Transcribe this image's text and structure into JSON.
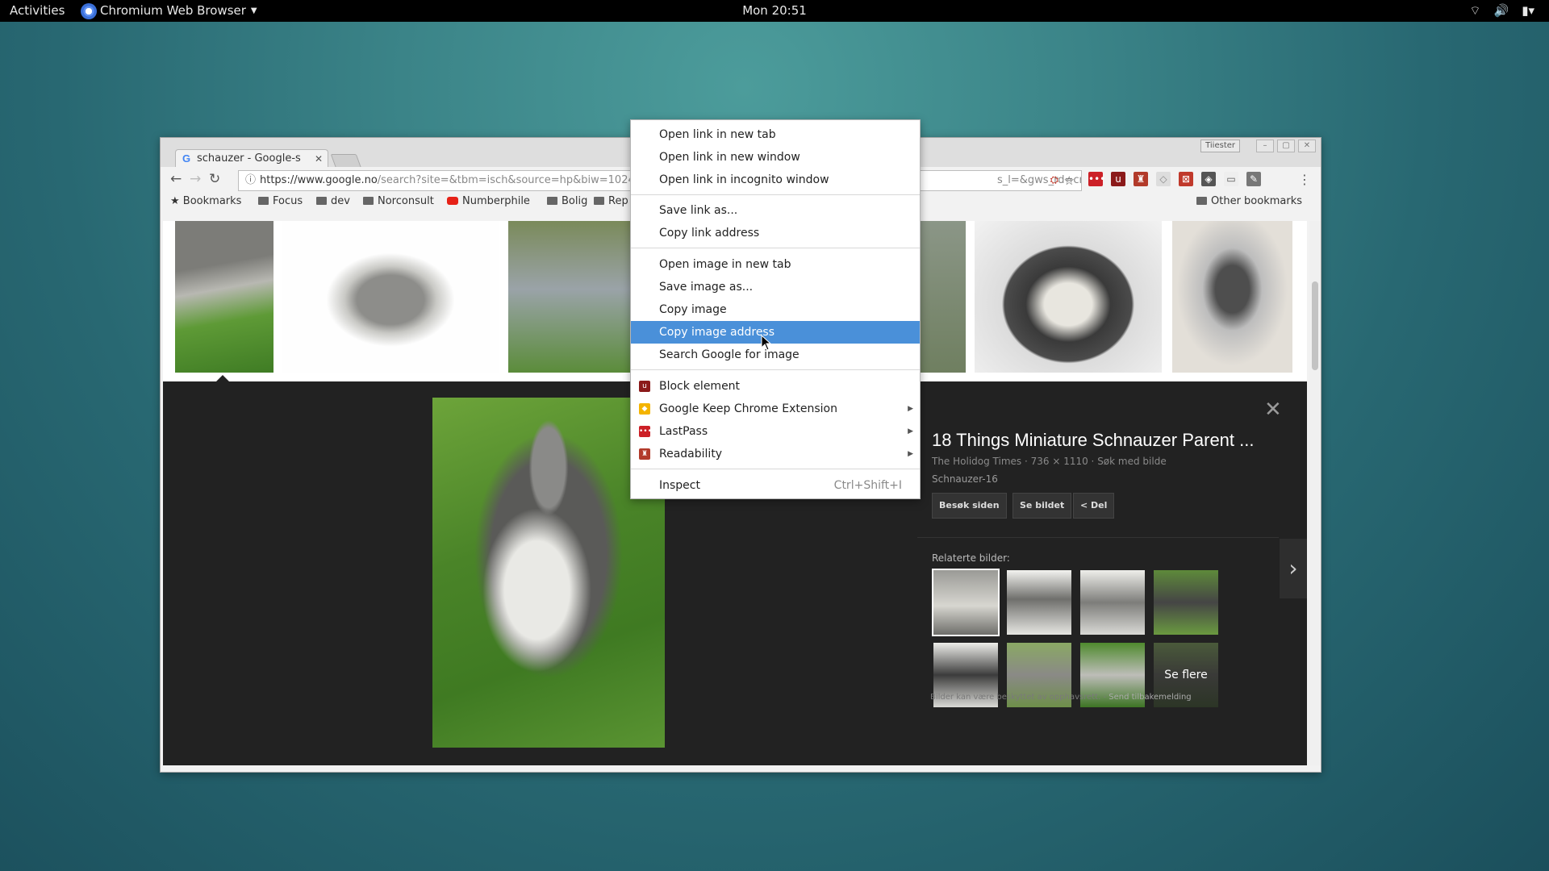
{
  "topbar": {
    "activities": "Activities",
    "app_name": "Chromium Web Browser",
    "clock": "Mon 20:51"
  },
  "browser": {
    "tab_title": "schauzer - Google-s",
    "profile_button": "Tiiester",
    "url_host": "https://www.google.no",
    "url_path": "/search?site=&tbm=isch&source=hp&biw=1024",
    "url_right": "s_l=&gws_rd=cr&ei=i5",
    "bookmarks": {
      "bookmarks": "Bookmarks",
      "focus": "Focus",
      "dev": "dev",
      "norconsult": "Norconsult",
      "numberphile": "Numberphile",
      "bolig": "Bolig",
      "rep": "Rep",
      "other": "Other bookmarks"
    }
  },
  "panel": {
    "title": "18 Things Miniature Schnauzer Parent ...",
    "meta": "The Holidog Times · 736 × 1110 · Søk med bilde",
    "subtitle": "Schnauzer-16",
    "visit_button": "Besøk siden",
    "view_button": "Se bildet",
    "share_button": "Del",
    "related_label": "Relaterte bilder:",
    "see_more": "Se flere",
    "copyright": "Bilder kan være beskyttet av opphavsrett. -",
    "feedback": "Send tilbakemelding"
  },
  "context_menu": {
    "open_new_tab": "Open link in new tab",
    "open_new_window": "Open link in new window",
    "open_incognito": "Open link in incognito window",
    "save_link": "Save link as...",
    "copy_link": "Copy link address",
    "open_image": "Open image in new tab",
    "save_image": "Save image as...",
    "copy_image": "Copy image",
    "copy_image_address": "Copy image address",
    "search_image": "Search Google for image",
    "block_element": "Block element",
    "keep_ext": "Google Keep Chrome Extension",
    "lastpass": "LastPass",
    "readability": "Readability",
    "inspect": "Inspect",
    "inspect_shortcut": "Ctrl+Shift+I"
  },
  "colors": {
    "menu_highlight": "#4a90d9",
    "panel_background": "#222222",
    "desktop_teal": "#3b8488"
  },
  "icons": [
    "chromium-icon",
    "wifi-icon",
    "volume-icon",
    "battery-icon",
    "star-icon",
    "folder-icon",
    "youtube-icon",
    "ublock-icon",
    "keep-icon",
    "lastpass-icon",
    "readability-icon",
    "close-icon",
    "chevron-right-icon",
    "share-icon"
  ]
}
